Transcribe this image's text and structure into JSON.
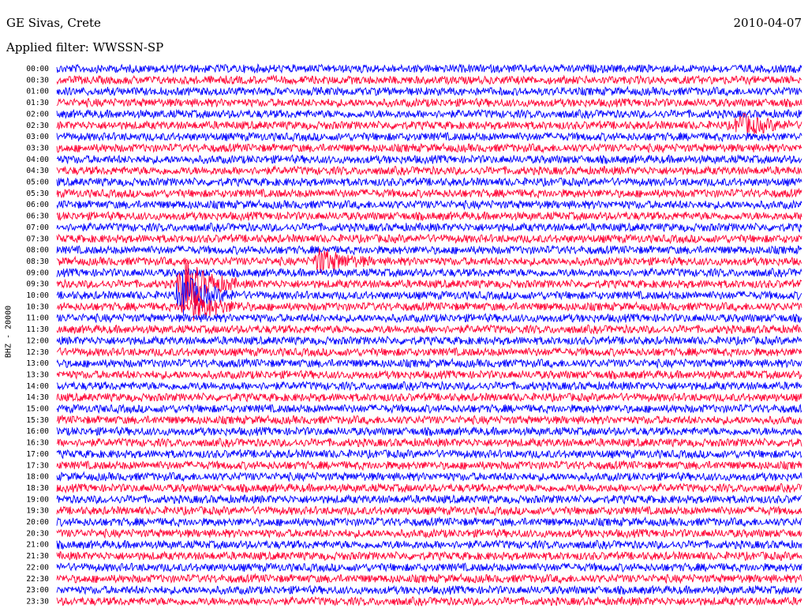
{
  "header": {
    "station": "GE Sivas, Crete",
    "date": "2010-04-07",
    "filter": "Applied filter: WWSSN-SP"
  },
  "chart_data": {
    "type": "line",
    "title": "GE Sivas, Crete",
    "ylabel": "BHZ - 20000",
    "row_labels": [
      "00:00",
      "00:30",
      "01:00",
      "01:30",
      "02:00",
      "02:30",
      "03:00",
      "03:30",
      "04:00",
      "04:30",
      "05:00",
      "05:30",
      "06:00",
      "06:30",
      "07:00",
      "07:30",
      "08:00",
      "08:30",
      "09:00",
      "09:30",
      "10:00",
      "10:30",
      "11:00",
      "11:30",
      "12:00",
      "12:30",
      "13:00",
      "13:30",
      "14:00",
      "14:30",
      "15:00",
      "15:30",
      "16:00",
      "16:30",
      "17:00",
      "17:30",
      "18:00",
      "18:30",
      "19:00",
      "19:30",
      "20:00",
      "20:30",
      "21:00",
      "21:30",
      "22:00",
      "22:30",
      "23:00",
      "23:30"
    ],
    "trace_colors": [
      "#0000ff",
      "#ff0033"
    ],
    "row_minutes": 30,
    "events": [
      {
        "row": "02:30",
        "minute": 27.5,
        "amplitude": 1.6
      },
      {
        "row": "08:30",
        "minute": 10.5,
        "amplitude": 2.0
      },
      {
        "row": "09:30",
        "minute": 5.0,
        "amplitude": 4.5
      },
      {
        "row": "10:00",
        "minute": 5.0,
        "amplitude": 3.5
      },
      {
        "row": "10:30",
        "minute": 5.5,
        "amplitude": 2.0
      }
    ]
  }
}
